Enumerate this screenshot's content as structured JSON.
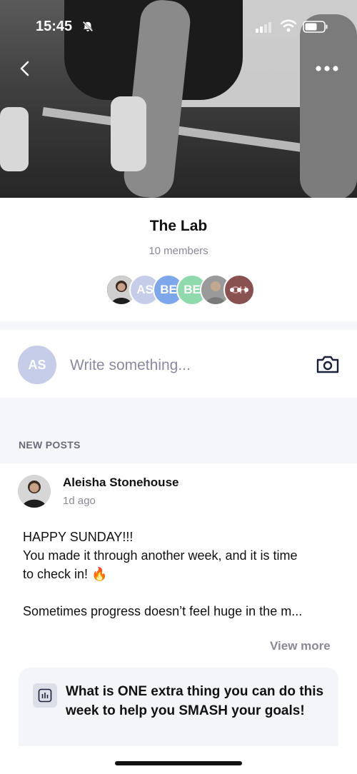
{
  "status_bar": {
    "time": "15:45"
  },
  "group": {
    "title": "The Lab",
    "member_count": "10 members",
    "member_avatars": [
      {
        "initials": "",
        "color": "#3a3a3a",
        "type": "photo"
      },
      {
        "initials": "AS",
        "color": "#c6cde8"
      },
      {
        "initials": "BE",
        "color": "#7ea7ea"
      },
      {
        "initials": "BE",
        "color": "#8fd9ad"
      },
      {
        "initials": "",
        "color": "#8a8a8a",
        "type": "photo"
      },
      {
        "initials": "CH",
        "color": "#8a5151",
        "overlay": "more-icon"
      }
    ]
  },
  "composer": {
    "avatar_initials": "AS",
    "placeholder": "Write something..."
  },
  "section": {
    "new_posts_label": "NEW POSTS"
  },
  "post": {
    "author": "Aleisha Stonehouse",
    "time": "1d ago",
    "body_lines": [
      "HAPPY SUNDAY!!!",
      "You made it through another week, and it is time",
      "to check in! 🔥",
      "",
      "Sometimes progress doesn’t feel huge in the m..."
    ],
    "view_more_label": "View more",
    "poll_question": "What is ONE extra thing you can do this week to help you SMASH your goals!"
  },
  "icons": {
    "back": "chevron-left-icon",
    "more": "more-horizontal-icon",
    "camera": "camera-icon",
    "poll": "poll-icon"
  },
  "colors": {
    "accent_muted": "#8a8a96",
    "background_alt": "#f5f6fa",
    "card_bg": "#f4f5f9"
  }
}
